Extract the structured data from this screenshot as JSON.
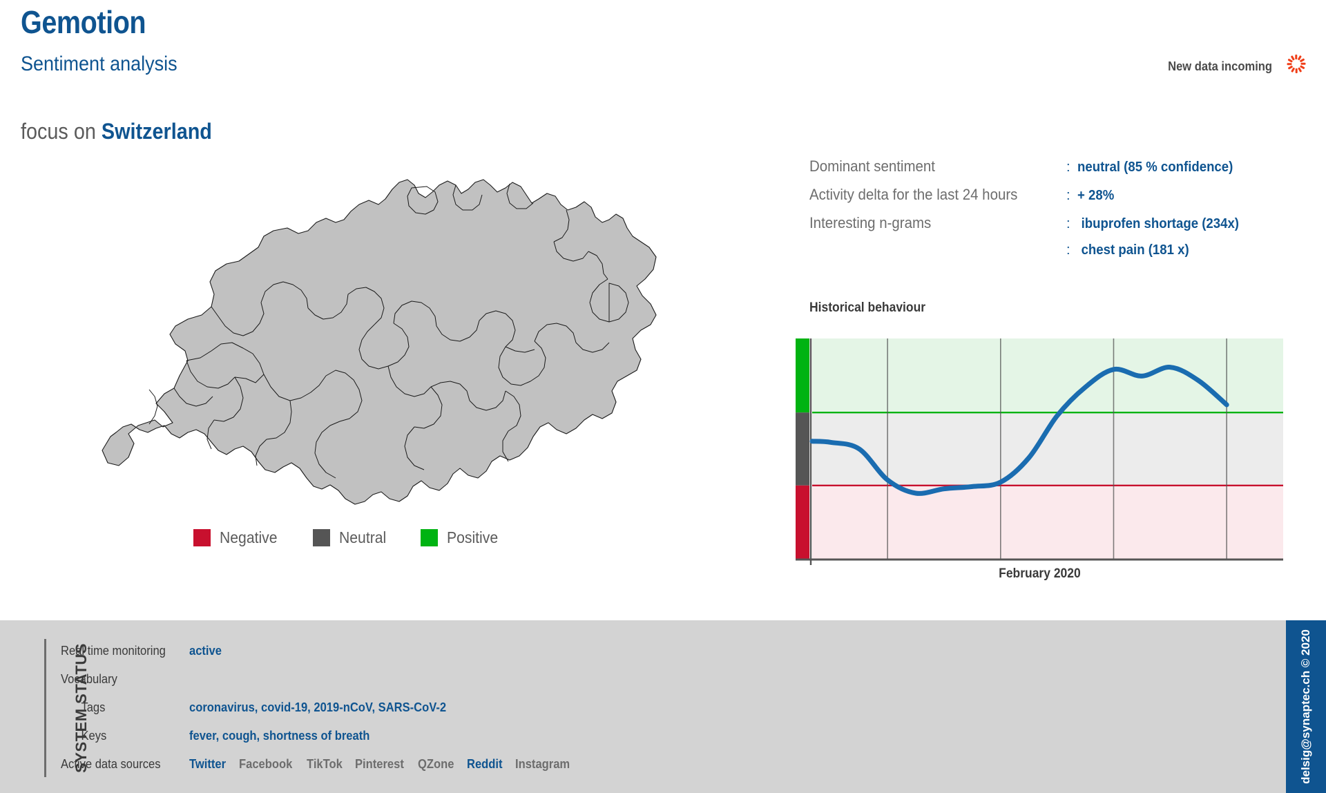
{
  "header": {
    "title": "Gemotion",
    "subtitle": "Sentiment analysis",
    "focus_prefix": "focus on ",
    "focus_country": "Switzerland",
    "new_data_label": "New data incoming",
    "spinner_icon": "loading-spinner-icon",
    "accent_blue": "#0f5490",
    "spinner_color": "#f03e18"
  },
  "map": {
    "region": "Switzerland",
    "fill": "#c1c1c1",
    "stroke": "#1a1a1a"
  },
  "legend": {
    "items": [
      {
        "label": "Negative",
        "color": "#c8102e",
        "name": "legend-negative"
      },
      {
        "label": "Neutral",
        "color": "#555555",
        "name": "legend-neutral"
      },
      {
        "label": "Positive",
        "color": "#00b312",
        "name": "legend-positive"
      }
    ]
  },
  "info": {
    "rows": [
      {
        "label": "Dominant sentiment",
        "colon": ":",
        "value": "neutral (85 % confidence)"
      },
      {
        "label": "Activity delta for the last 24 hours",
        "colon": ":",
        "value": "+ 28%"
      },
      {
        "label": "Interesting n-grams",
        "colon": ":",
        "value": "ibuprofen shortage (234x)"
      },
      {
        "label": "",
        "colon": ":",
        "value": "chest pain (181 x)"
      }
    ]
  },
  "chart_data": {
    "type": "line",
    "title": "Historical behaviour",
    "xlabel": "February 2020",
    "ylabel": "",
    "grid": true,
    "legend_position": "none",
    "ylim": [
      -1,
      1
    ],
    "y_bands": [
      {
        "name": "Positive",
        "from": 0.33,
        "to": 1.0,
        "fill": "#e4f5e6",
        "edge": "#00b312",
        "bar": "#00b312"
      },
      {
        "name": "Neutral",
        "from": -0.33,
        "to": 0.33,
        "fill": "#ececec",
        "edge": "#c8102e",
        "bar": "#555555"
      },
      {
        "name": "Negative",
        "from": -1.0,
        "to": -0.33,
        "fill": "#fbe9ec",
        "edge": "#c8102e",
        "bar": "#c8102e"
      }
    ],
    "x": [
      0,
      0.04,
      0.1,
      0.16,
      0.22,
      0.28,
      0.34,
      0.4,
      0.46,
      0.52,
      0.58,
      0.64,
      0.7,
      0.76,
      0.82,
      0.88
    ],
    "series": [
      {
        "name": "Sentiment",
        "color": "#1a6cb0",
        "values": [
          0.07,
          0.06,
          0.0,
          -0.28,
          -0.4,
          -0.36,
          -0.34,
          -0.3,
          -0.08,
          0.3,
          0.56,
          0.72,
          0.66,
          0.74,
          0.62,
          0.4
        ]
      }
    ],
    "x_gridlines": [
      0.16,
      0.4,
      0.64,
      0.88
    ],
    "axis_color": "#555555"
  },
  "footer": {
    "section_title": "SYSTEM STATUS",
    "rows": [
      {
        "label": "Real time monitoring",
        "value": "active",
        "indent": false
      },
      {
        "label": "Vocabulary",
        "value": "",
        "indent": false
      },
      {
        "label": "Tags",
        "value": "coronavirus, covid-19, 2019-nCoV, SARS-CoV-2",
        "indent": true
      },
      {
        "label": "Keys",
        "value": "fever, cough, shortness of breath",
        "indent": true
      }
    ],
    "sources_label": "Active data sources",
    "sources": [
      {
        "name": "Twitter",
        "active": true
      },
      {
        "name": "Facebook",
        "active": false
      },
      {
        "name": "TikTok",
        "active": false
      },
      {
        "name": "Pinterest",
        "active": false
      },
      {
        "name": "QZone",
        "active": false
      },
      {
        "name": "Reddit",
        "active": true
      },
      {
        "name": "Instagram",
        "active": false
      }
    ],
    "background": "#d3d3d3"
  },
  "copyright": {
    "text": "delsig@synaptec.ch © 2020",
    "background": "#0f5490"
  }
}
